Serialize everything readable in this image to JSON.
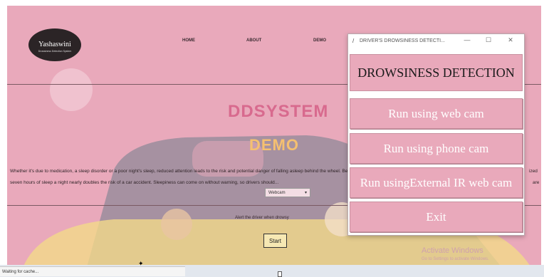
{
  "website": {
    "logo": {
      "name": "Yashaswini",
      "tagline": "Drowsiness Detection System"
    },
    "nav": [
      "HOME",
      "ABOUT",
      "DEMO"
    ],
    "title_line1": "DDSYSTEM",
    "title_line2": "DEMO",
    "paragraph": [
      "Whether it's due to medication, a sleep disorder or a poor night's sleep, reduced attention leads to the risk and potential danger of falling asleep behind the wheel. Being awake for less than five to six hours and just fewer than",
      "seven hours of sleep a night nearly doubles the risk of a car accident. Sleepiness can come on without warning, so drivers should..."
    ],
    "paragraph_tail_1": "ized",
    "paragraph_tail_2": "are",
    "select_value": "Webcam",
    "hint": "Alert the driver when drowsy",
    "start_label": "Start",
    "watermark_title": "Activate Windows",
    "watermark_sub": "Go to Settings to activate Windows."
  },
  "statusbar": {
    "text": "Waiting for cache..."
  },
  "app_window": {
    "title": "DRIVER'S DROWSINESS DETECTI...",
    "controls": {
      "minimize": "—",
      "maximize": "☐",
      "close": "✕"
    },
    "heading": "DROWSINESS DETECTION",
    "buttons": [
      "Run using web cam",
      "Run using phone cam",
      "Run usingExternal IR web cam",
      "Exit"
    ]
  },
  "colors": {
    "background": "#e9a9bb",
    "button_text": "#ffffff",
    "heading_text": "#1a1a1a"
  },
  "icons": {
    "window_icon": "feather-icon",
    "cursor": "mouse-cursor-icon"
  }
}
